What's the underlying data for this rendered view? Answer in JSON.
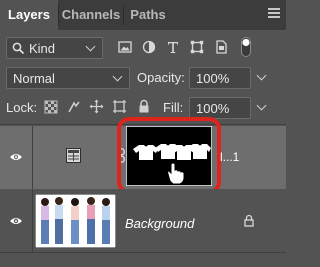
{
  "tabs": [
    {
      "label": "Layers"
    },
    {
      "label": "Channels"
    },
    {
      "label": "Paths"
    }
  ],
  "filter": {
    "kind_label": "Kind"
  },
  "blend": {
    "mode": "Normal",
    "opacity_label": "Opacity:",
    "opacity_value": "100%"
  },
  "lock": {
    "label": "Lock:",
    "fill_label": "Fill:",
    "fill_value": "100%"
  },
  "layers": [
    {
      "name": "l...1",
      "visible": true,
      "selected": true
    },
    {
      "name": "Background",
      "visible": true,
      "locked": true
    }
  ],
  "colors": {
    "highlight": "#e0231d",
    "panel": "#535353",
    "tabbar": "#3c3c3c"
  }
}
